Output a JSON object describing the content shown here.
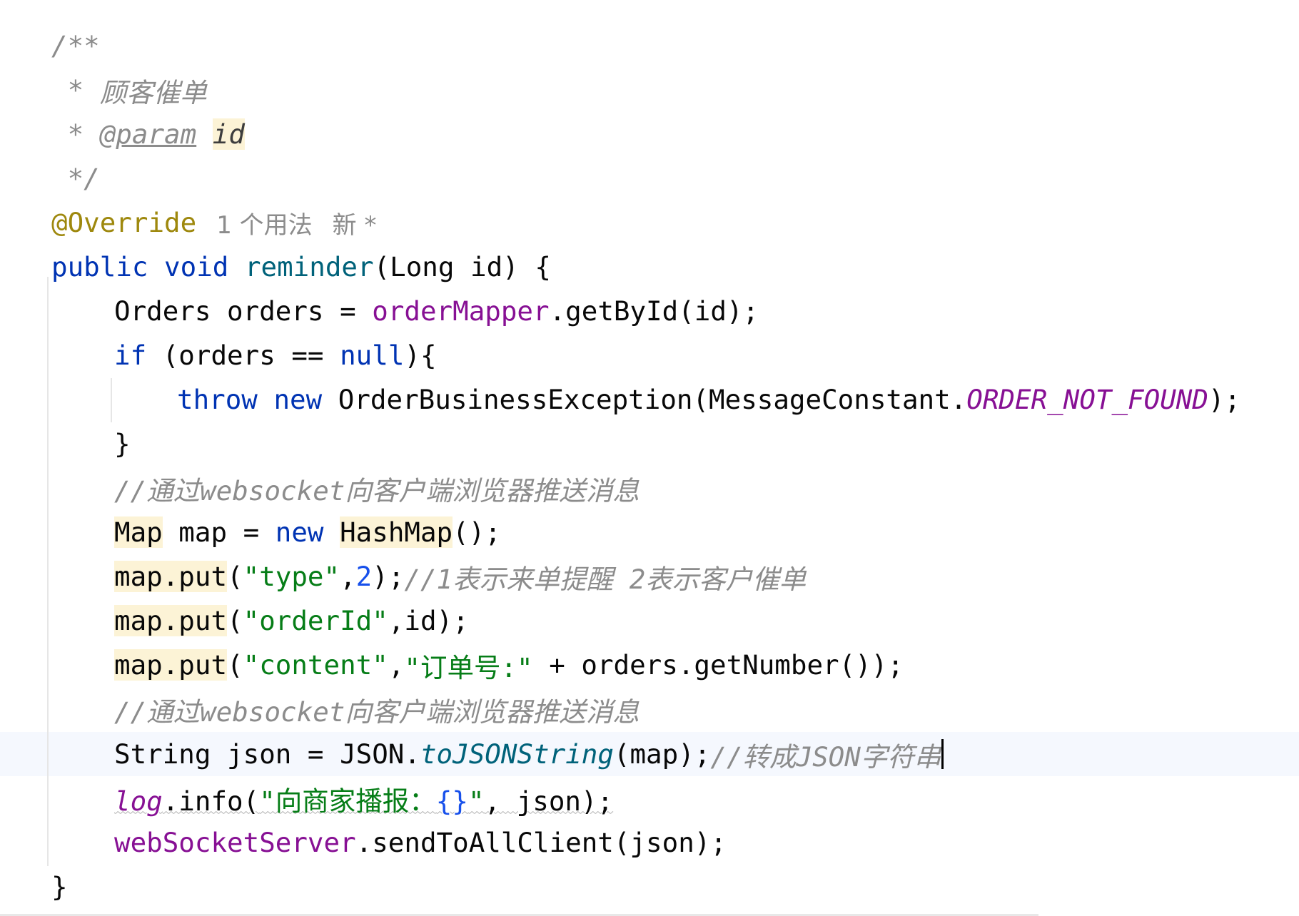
{
  "code": {
    "doc_open": "/**",
    "doc_title_star": " * ",
    "doc_title": "顾客催单",
    "doc_param_star": " * ",
    "doc_param_tag": "@param",
    "doc_param_name": "id",
    "doc_close": " */",
    "annotation": "@Override",
    "usage_hint": "1 个用法",
    "new_hint": "新 *",
    "l6": {
      "kw_public": "public",
      "kw_void": "void",
      "method": "reminder",
      "params": "(Long id) {"
    },
    "l7": {
      "type": "Orders orders = ",
      "field": "orderMapper",
      "rest": ".getById(id);"
    },
    "l8": {
      "kw_if": "if",
      "cond": " (orders == ",
      "kw_null": "null",
      "tail": "){"
    },
    "l9": {
      "kw_throw": "throw",
      "kw_new": "new",
      "cls": " OrderBusinessException(MessageConstant.",
      "const": "ORDER_NOT_FOUND",
      "tail": ");"
    },
    "l10": {
      "brace": "}"
    },
    "l11": {
      "comment": "//通过websocket向客户端浏览器推送消息"
    },
    "l12": {
      "map_type": "Map",
      "mid": " map = ",
      "kw_new": "new",
      "hashmap": "HashMap",
      "tail": "();"
    },
    "l13": {
      "mapput": "map.put",
      "open": "(",
      "str": "\"type\"",
      "comma": ",",
      "num": "2",
      "close": ");",
      "comment": "//1表示来单提醒 2表示客户催单"
    },
    "l14": {
      "mapput": "map.put",
      "open": "(",
      "str": "\"orderId\"",
      "rest": ",id);"
    },
    "l15": {
      "mapput": "map.put",
      "open": "(",
      "str1": "\"content\"",
      "comma": ",",
      "str2": "\"订单号:\"",
      "rest": " + orders.getNumber());"
    },
    "l16": {
      "comment": "//通过websocket向客户端浏览器推送消息"
    },
    "l17": {
      "head": "String json = JSON.",
      "sfn": "toJSONString",
      "mid": "(map);",
      "comment": "//转成JSON字符串"
    },
    "l18": {
      "log": "log",
      "info": ".info(",
      "str_a": "\"向商家播报：",
      "brace": "{}",
      "str_b": "\"",
      "rest": ", json);"
    },
    "l19": {
      "field": "webSocketServer",
      "rest": ".sendToAllClient(json);"
    },
    "l20": {
      "brace": "}"
    }
  }
}
